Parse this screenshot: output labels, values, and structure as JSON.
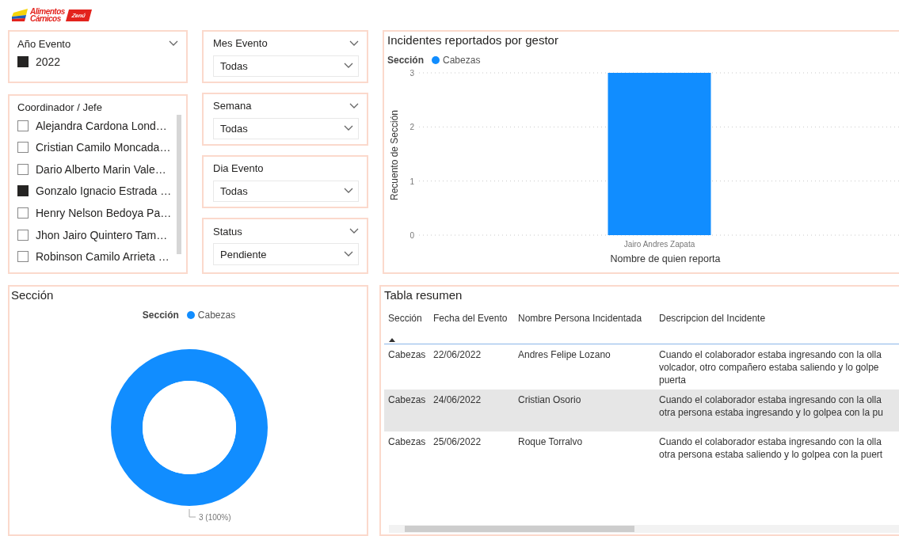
{
  "logo": {
    "brand": "Alimentos",
    "brand_line2": "Cárnicos",
    "mark": "Zenú"
  },
  "year_slicer": {
    "title": "Año Evento",
    "items": [
      {
        "label": "2022",
        "checked": true
      }
    ]
  },
  "coordinator_slicer": {
    "title": "Coordinador / Jefe",
    "items": [
      {
        "label": "Alejandra Cardona Lond…",
        "checked": false
      },
      {
        "label": "Cristian Camilo Moncada…",
        "checked": false
      },
      {
        "label": "Dario Alberto Marin Vale…",
        "checked": false
      },
      {
        "label": "Gonzalo Ignacio Estrada …",
        "checked": true
      },
      {
        "label": "Henry Nelson Bedoya Pa…",
        "checked": false
      },
      {
        "label": "Jhon Jairo Quintero Tam…",
        "checked": false
      },
      {
        "label": "Robinson Camilo Arrieta …",
        "checked": false
      }
    ]
  },
  "dropdown_slicers": [
    {
      "title": "Mes Evento",
      "value": "Todas"
    },
    {
      "title": "Semana",
      "value": "Todas"
    },
    {
      "title": "Dia Evento",
      "value": "Todas"
    },
    {
      "title": "Status",
      "value": "Pendiente"
    }
  ],
  "bar_panel": {
    "title": "Incidentes reportados por gestor",
    "legend_title": "Sección",
    "chart_data": {
      "type": "bar",
      "xlabel": "Nombre de quien reporta",
      "ylabel": "Recuento de Sección",
      "categories": [
        "Jairo Andres Zapata"
      ],
      "series": [
        {
          "name": "Cabezas",
          "color": "#118dff",
          "values": [
            3
          ]
        }
      ],
      "ylim": [
        0,
        3
      ],
      "yticks": [
        0,
        1,
        2,
        3
      ]
    }
  },
  "donut_panel": {
    "title": "Sección",
    "legend_title": "Sección",
    "chart_data": {
      "type": "donut",
      "series": [
        {
          "name": "Cabezas",
          "color": "#118dff",
          "values": [
            100
          ]
        }
      ],
      "value_labels": [
        "3 (100%)"
      ]
    }
  },
  "table": {
    "title": "Tabla resumen",
    "columns": [
      "Sección",
      "Fecha del Evento",
      "Nombre Persona Incidentada",
      "Descripcion del Incidente"
    ],
    "rows": [
      {
        "cells": [
          "Cabezas",
          "22/06/2022",
          "Andres Felipe Lozano",
          "Cuando el colaborador estaba ingresando con la olla\nvolcador, otro compañero estaba saliendo y lo golpe\npuerta"
        ],
        "selected": false
      },
      {
        "cells": [
          "Cabezas",
          "24/06/2022",
          "Cristian Osorio",
          "Cuando el colaborador estaba ingresando con la olla\notra persona estaba ingresando y lo golpea con la pu"
        ],
        "selected": true
      },
      {
        "cells": [
          "Cabezas",
          "25/06/2022",
          "Roque Torralvo",
          "Cuando el colaborador estaba ingresando con la olla\notra persona estaba saliendo y lo golpea con la puert"
        ],
        "selected": false
      }
    ]
  }
}
